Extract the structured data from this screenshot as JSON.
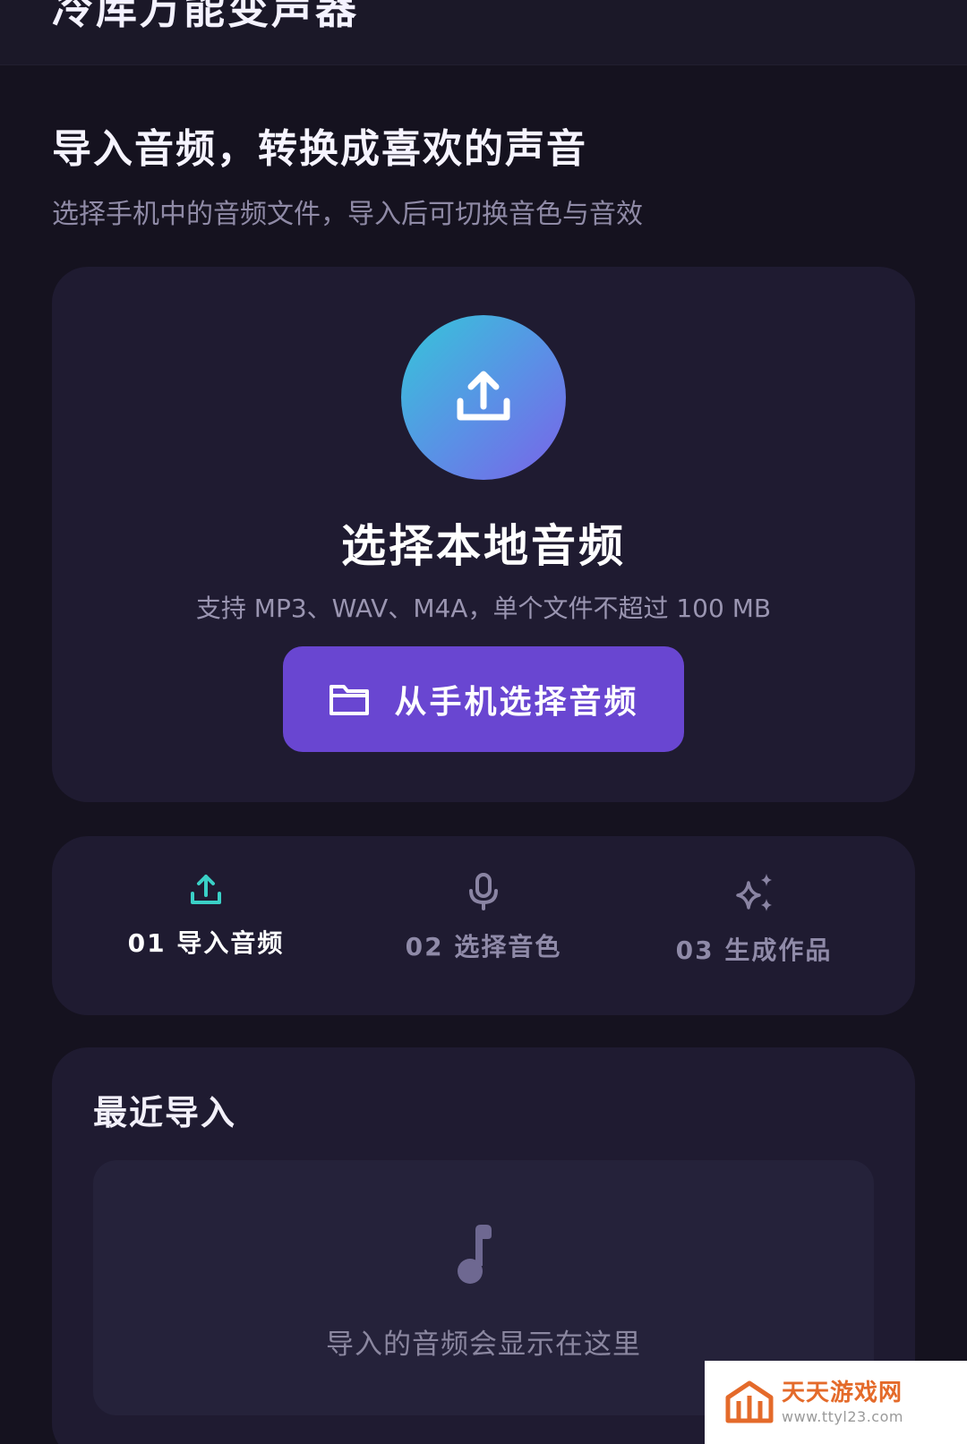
{
  "header": {
    "app_title": "冷库万能变声器"
  },
  "intro": {
    "headline": "导入音频，转换成喜欢的声音",
    "subline": "选择手机中的音频文件，导入后可切换音色与音效"
  },
  "upload": {
    "icon": "upload-icon",
    "title": "选择本地音频",
    "note": "支持 MP3、WAV、M4A，单个文件不超过 100 MB",
    "button_icon": "folder-icon",
    "button_label": "从手机选择音频"
  },
  "steps": [
    {
      "label": "01 导入音频",
      "icon": "upload-icon",
      "active": true,
      "color": "#3ad0c6"
    },
    {
      "label": "02 选择音色",
      "icon": "microphone-icon",
      "active": false,
      "color": "#8a84a3"
    },
    {
      "label": "03 生成作品",
      "icon": "sparkles-icon",
      "active": false,
      "color": "#8a84a3"
    }
  ],
  "recent": {
    "title": "最近导入",
    "empty_icon": "music-note-icon",
    "empty_text": "导入的音频会显示在这里"
  },
  "watermark": {
    "name": "天天游戏网",
    "url": "www.ttyl23.com"
  },
  "colors": {
    "background": "#15121f",
    "card": "#1f1b31",
    "accent": "#6946d1",
    "active_step": "#3ad0c6"
  }
}
